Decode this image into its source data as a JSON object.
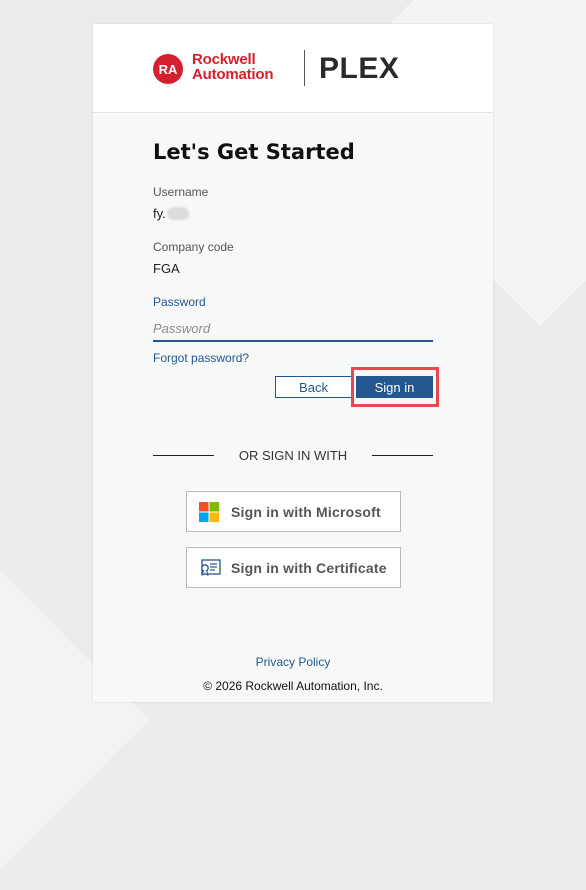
{
  "branding": {
    "rockwell_line1": "Rockwell",
    "rockwell_line2": "Automation",
    "logo_initials": "RA",
    "product": "PLEX",
    "brand_red": "#d5202f"
  },
  "form": {
    "title": "Let's Get Started",
    "username_label": "Username",
    "username_value": "fy.",
    "company_label": "Company code",
    "company_value": "FGA",
    "password_label": "Password",
    "password_placeholder": "Password",
    "password_value": "",
    "forgot_label": "Forgot password?"
  },
  "actions": {
    "back_label": "Back",
    "signin_label": "Sign in",
    "accent_color": "#24578f",
    "highlight_color": "#e8484e"
  },
  "alternate": {
    "divider_text": "OR SIGN IN WITH",
    "microsoft_label": "Sign in with Microsoft",
    "microsoft_icon": "microsoft-logo-icon",
    "certificate_label": "Sign in with Certificate",
    "certificate_icon": "certificate-icon"
  },
  "footer": {
    "privacy_label": "Privacy Policy",
    "copyright": "© 2026 Rockwell Automation, Inc."
  }
}
